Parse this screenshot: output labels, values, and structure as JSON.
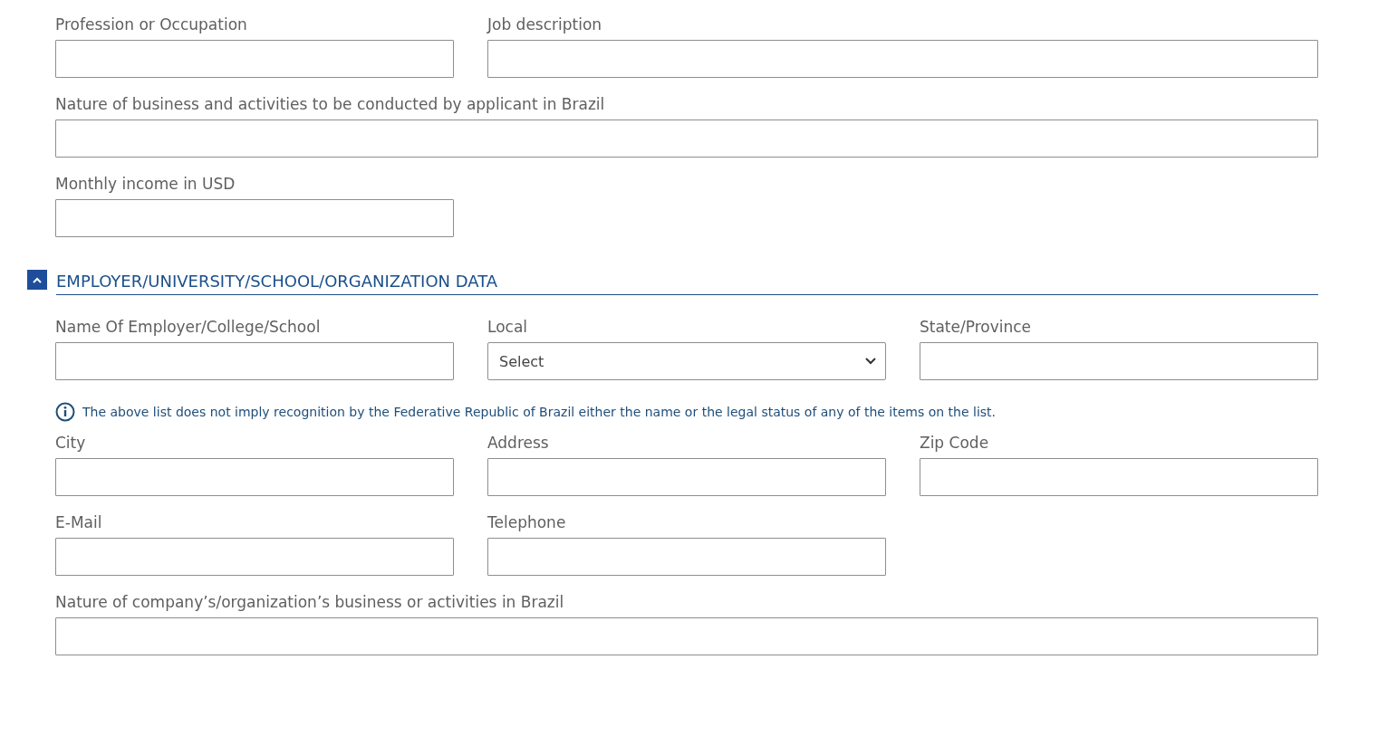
{
  "top_rows": [
    [
      {
        "kind": "text",
        "label": "Profession or Occupation"
      },
      {
        "kind": "wide",
        "label": "Job description"
      }
    ],
    [
      {
        "kind": "full",
        "label": "Nature of business and activities to be conducted by applicant in Brazil"
      }
    ],
    [
      {
        "kind": "text",
        "label": "Monthly income in USD"
      }
    ]
  ],
  "section": {
    "title": "EMPLOYER/UNIVERSITY/SCHOOL/ORGANIZATION DATA",
    "expanded": true,
    "rows_before_note": [
      [
        {
          "kind": "text",
          "label": "Name Of Employer/College/School"
        },
        {
          "kind": "select",
          "label": "Local",
          "value": "Select"
        },
        {
          "kind": "text",
          "label": "State/Province"
        }
      ]
    ],
    "note": "The above list does not imply recognition by the Federative Republic of Brazil either the name or the legal status of any of the items on the list.",
    "rows_after_note": [
      [
        {
          "kind": "text",
          "label": "City"
        },
        {
          "kind": "text",
          "label": "Address"
        },
        {
          "kind": "text",
          "label": "Zip Code"
        }
      ],
      [
        {
          "kind": "text",
          "label": "E-Mail"
        },
        {
          "kind": "text",
          "label": "Telephone"
        }
      ],
      [
        {
          "kind": "full",
          "label": "Nature of company’s/organization’s business or activities in Brazil"
        }
      ]
    ]
  }
}
